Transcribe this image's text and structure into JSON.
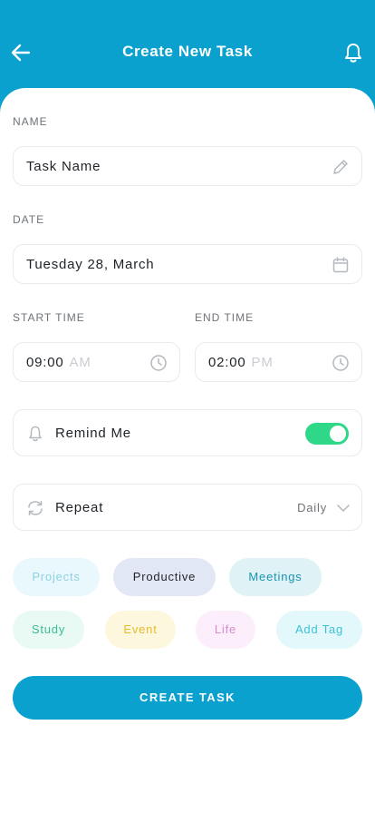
{
  "header": {
    "title": "Create New Task",
    "back_icon": "arrow-left-icon",
    "bell_icon": "bell-icon"
  },
  "form": {
    "name_label": "NAME",
    "name_value": "Task Name",
    "date_label": "DATE",
    "date_value": "Tuesday 28, March",
    "start_label": "START TIME",
    "start_value": "09:00",
    "start_period": "AM",
    "end_label": "END TIME",
    "end_value": "02:00",
    "end_period": "PM"
  },
  "remind": {
    "label": "Remind Me",
    "enabled": true
  },
  "repeat": {
    "label": "Repeat",
    "value": "Daily"
  },
  "tags": [
    {
      "label": "Projects",
      "bg": "#e9f8fc",
      "fg": "#8fd1e4"
    },
    {
      "label": "Productive",
      "bg": "#e1e7f5",
      "fg": "#1f2328"
    },
    {
      "label": "Meetings",
      "bg": "#dff3f7",
      "fg": "#1a93b5"
    },
    {
      "label": "Study",
      "bg": "#e8faf3",
      "fg": "#3bbf91"
    },
    {
      "label": "Event",
      "bg": "#fdf7dd",
      "fg": "#e6bc2a"
    },
    {
      "label": "Life",
      "bg": "#fdeefb",
      "fg": "#d48bcf"
    },
    {
      "label": "Add Tag",
      "bg": "#e3f8fb",
      "fg": "#3ec1d6"
    }
  ],
  "actions": {
    "create_label": "CREATE TASK"
  },
  "colors": {
    "primary": "#0aa1cf",
    "toggle_on": "#2fd889",
    "border": "#e8eaee"
  }
}
